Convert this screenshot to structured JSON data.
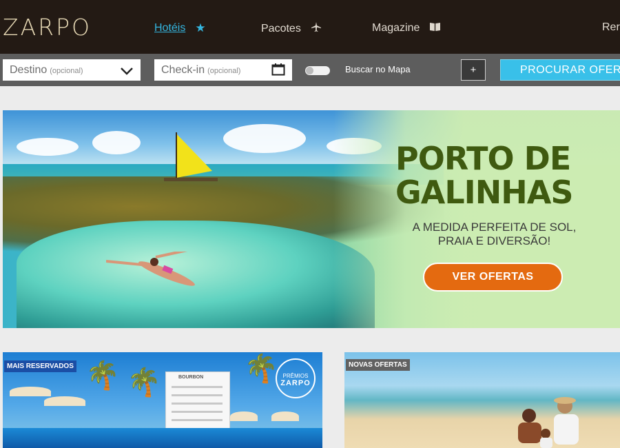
{
  "header": {
    "logo": "ZARPO",
    "nav": [
      {
        "label": "Hotéis",
        "icon": "star-icon",
        "active": true
      },
      {
        "label": "Pacotes",
        "icon": "airplane-icon",
        "active": false
      },
      {
        "label": "Magazine",
        "icon": "book-icon",
        "active": false
      },
      {
        "label": "Rer",
        "icon": "",
        "active": false
      }
    ]
  },
  "search": {
    "destination_label": "Destino",
    "destination_hint": "(opcional)",
    "checkin_label": "Check-in",
    "checkin_hint": "(opcional)",
    "map_toggle_label": "Buscar no Mapa",
    "map_toggle_on": false,
    "plus_label": "+",
    "submit_label": "PROCURAR OFER"
  },
  "hero": {
    "title_line1": "PORTO DE",
    "title_line2": "GALINHAS",
    "subtitle_line1": "A MEDIDA PERFEITA DE SOL,",
    "subtitle_line2": "PRAIA E DIVERSÃO!",
    "cta_label": "VER OFERTAS"
  },
  "cards": [
    {
      "badge": "MAIS RESERVADOS",
      "award_top": "PRÊMIOS",
      "award_name": "ZARPO",
      "hotel_sign": "BOURBON"
    },
    {
      "badge": "NOVAS OFERTAS"
    }
  ],
  "colors": {
    "header_bg": "#231a14",
    "accent": "#34b6e0",
    "search_bar_bg": "#5d5d5d",
    "search_button": "#39c0e9",
    "cta_orange": "#e46a10",
    "hero_title_green": "#3f5a10"
  }
}
